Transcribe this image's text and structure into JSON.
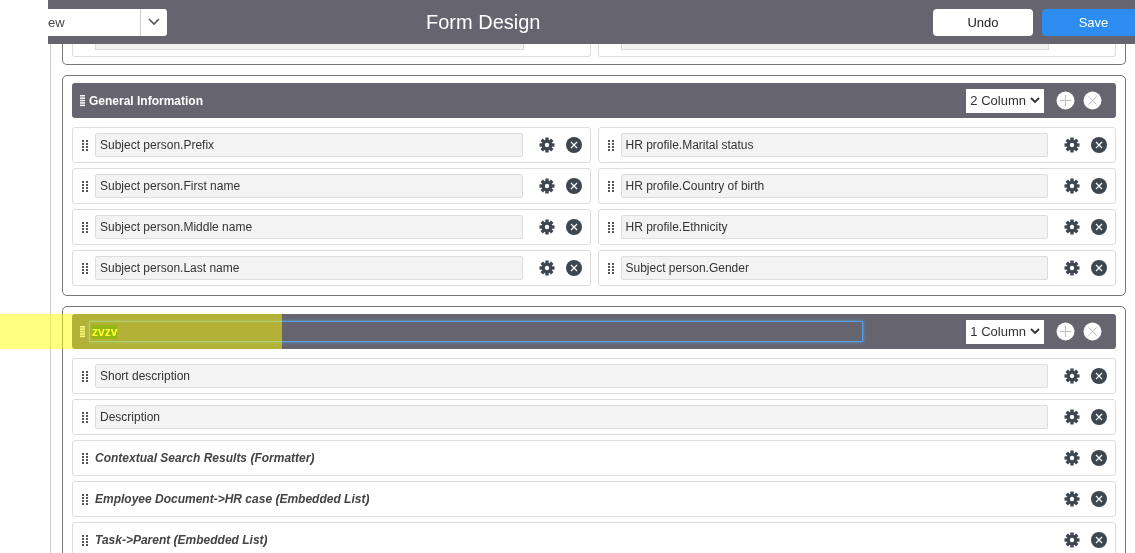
{
  "toolbar": {
    "view_select": "ew",
    "title": "Form Design",
    "buttons": [
      {
        "label": "Undo",
        "kind": "secondary"
      },
      {
        "label": "Save",
        "kind": "primary"
      }
    ]
  },
  "sections": [
    {
      "title": "General Information",
      "editing": false,
      "highlighted": false,
      "columns_select": "2 Column",
      "columns": [
        [
          {
            "kind": "field",
            "label": "Subject person.Prefix"
          },
          {
            "kind": "field",
            "label": "Subject person.First name"
          },
          {
            "kind": "field",
            "label": "Subject person.Middle name"
          },
          {
            "kind": "field",
            "label": "Subject person.Last name"
          }
        ],
        [
          {
            "kind": "field",
            "label": "HR profile.Marital status"
          },
          {
            "kind": "field",
            "label": "HR profile.Country of birth"
          },
          {
            "kind": "field",
            "label": "HR profile.Ethnicity"
          },
          {
            "kind": "field",
            "label": "Subject person.Gender"
          }
        ]
      ]
    },
    {
      "title": "zvzv",
      "editing": true,
      "highlighted": true,
      "columns_select": "1 Column",
      "columns": [
        [
          {
            "kind": "field",
            "label": "Short description"
          },
          {
            "kind": "field",
            "label": "Description"
          },
          {
            "kind": "formatter",
            "label": "Contextual Search Results (Formatter)"
          },
          {
            "kind": "formatter",
            "label": "Employee Document->HR case (Embedded List)"
          },
          {
            "kind": "formatter",
            "label": "Task->Parent (Embedded List)"
          }
        ]
      ]
    }
  ]
}
